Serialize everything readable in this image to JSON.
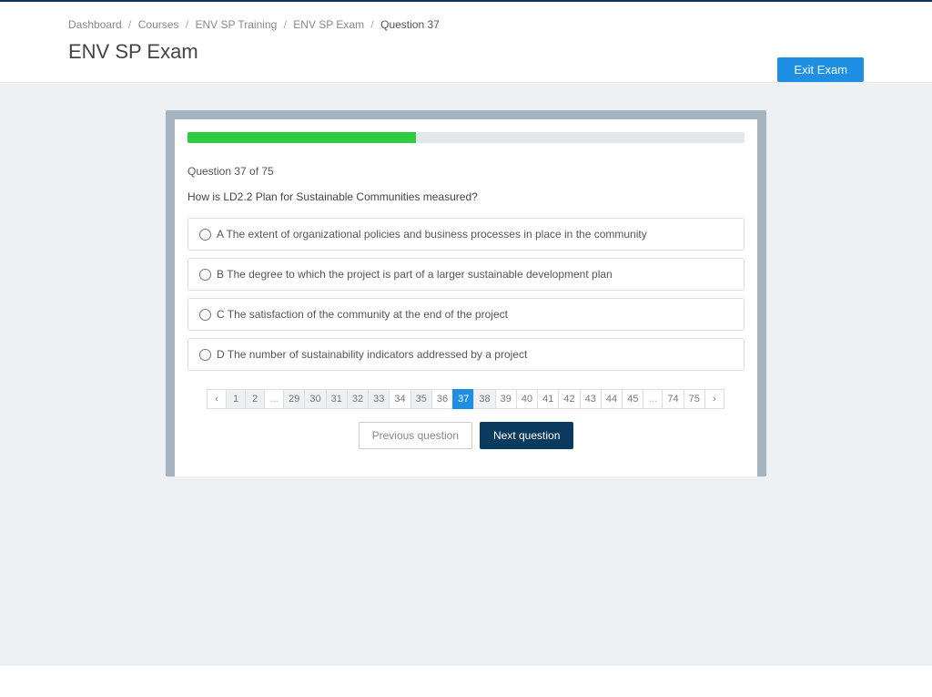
{
  "breadcrumb": {
    "items": [
      "Dashboard",
      "Courses",
      "ENV SP Training",
      "ENV SP Exam"
    ],
    "current": "Question 37"
  },
  "page_title": "ENV SP Exam",
  "exit_label": "Exit Exam",
  "progress_percent": 41,
  "question_counter": "Question 37 of 75",
  "question_text": "How is LD2.2 Plan for Sustainable Communities measured?",
  "answers": [
    {
      "letter": "A",
      "text": "The extent of organizational policies and business processes in place in the community"
    },
    {
      "letter": "B",
      "text": "The degree to which the project is part of a larger sustainable development plan"
    },
    {
      "letter": "C",
      "text": "The satisfaction of the community at the end of the project"
    },
    {
      "letter": "D",
      "text": "The number of sustainability indicators addressed by a project"
    }
  ],
  "pagination": {
    "prev_arrow": "‹",
    "next_arrow": "›",
    "leading": [
      "1",
      "2"
    ],
    "middle": [
      "29",
      "30",
      "31",
      "32",
      "33",
      "34",
      "35",
      "36",
      "37",
      "38",
      "39",
      "40",
      "41",
      "42",
      "43",
      "44",
      "45"
    ],
    "trailing": [
      "74",
      "75"
    ],
    "ellipsis": "...",
    "active": "37",
    "shaded": [
      "1",
      "2",
      "29",
      "30",
      "31",
      "32",
      "33",
      "35",
      "38"
    ]
  },
  "nav": {
    "prev": "Previous question",
    "next": "Next question"
  }
}
